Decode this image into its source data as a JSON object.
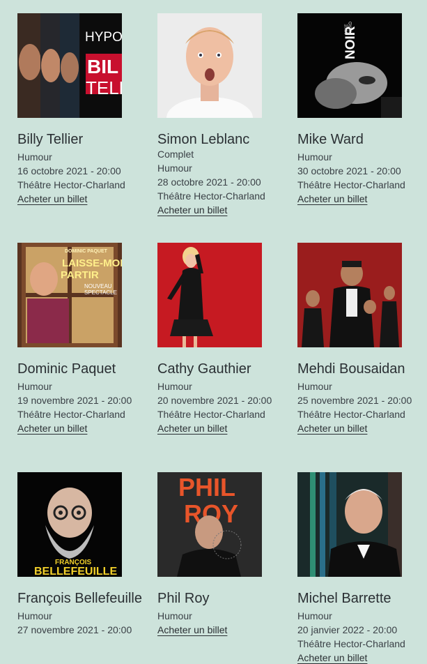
{
  "events": [
    {
      "name": "Billy Tellier",
      "category": "Humour",
      "date": "16 octobre 2021 - 20:00",
      "venue": "Théâtre Hector-Charland",
      "cta": "Acheter un billet",
      "poster_text": "HYPOC BIL TELL"
    },
    {
      "name": "Simon Leblanc",
      "status": "Complet",
      "category": "Humour",
      "date": "28 octobre 2021 - 20:00",
      "venue": "Théâtre Hector-Charland",
      "cta": "Acheter un billet"
    },
    {
      "name": "Mike Ward",
      "category": "Humour",
      "date": "30 octobre 2021 - 20:00",
      "venue": "Théâtre Hector-Charland",
      "cta": "Acheter un billet",
      "poster_text": "NOIR"
    },
    {
      "name": "Dominic Paquet",
      "category": "Humour",
      "date": "19 novembre 2021 - 20:00",
      "venue": "Théâtre Hector-Charland",
      "cta": "Acheter un billet",
      "poster_text": "LAISSE-MOI PARTIR"
    },
    {
      "name": "Cathy Gauthier",
      "category": "Humour",
      "date": "20 novembre 2021 - 20:00",
      "venue": "Théâtre Hector-Charland",
      "cta": "Acheter un billet"
    },
    {
      "name": "Mehdi Bousaidan",
      "category": "Humour",
      "date": "25 novembre 2021 - 20:00",
      "venue": "Théâtre Hector-Charland",
      "cta": "Acheter un billet"
    },
    {
      "name": "François Bellefeuille",
      "category": "Humour",
      "date": "27 novembre 2021 - 20:00",
      "poster_text": "FRANÇOIS BELLEFEUILLE"
    },
    {
      "name": "Phil Roy",
      "category": "Humour",
      "cta": "Acheter un billet",
      "poster_text": "PHIL ROY"
    },
    {
      "name": "Michel Barrette",
      "category": "Humour",
      "date": "20 janvier 2022 - 20:00",
      "venue": "Théâtre Hector-Charland",
      "cta": "Acheter un billet"
    }
  ]
}
